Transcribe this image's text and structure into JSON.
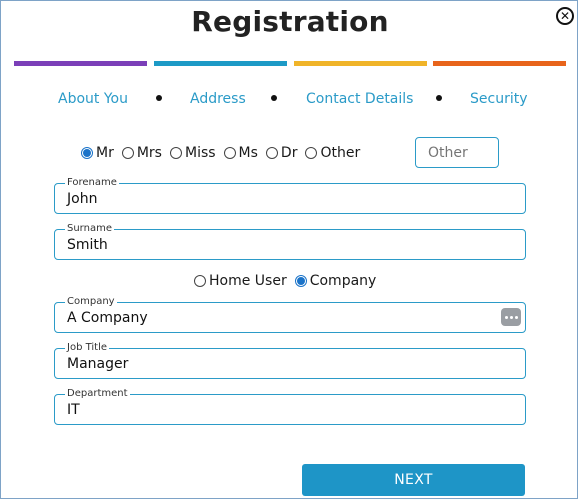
{
  "title": "Registration",
  "steps": [
    {
      "label": "About You",
      "color": "#7b3fb8"
    },
    {
      "label": "Address",
      "color": "#1d9ac6"
    },
    {
      "label": "Contact Details",
      "color": "#f0b429"
    },
    {
      "label": "Security",
      "color": "#e8641b"
    }
  ],
  "titles": {
    "options": [
      "Mr",
      "Mrs",
      "Miss",
      "Ms",
      "Dr",
      "Other"
    ],
    "selected": "Mr",
    "other_placeholder": "Other"
  },
  "forename": {
    "label": "Forename",
    "value": "John"
  },
  "surname": {
    "label": "Surname",
    "value": "Smith"
  },
  "user_type": {
    "options": [
      "Home User",
      "Company"
    ],
    "selected": "Company"
  },
  "company": {
    "label": "Company",
    "value": "A Company"
  },
  "job_title": {
    "label": "Job Title",
    "value": "Manager"
  },
  "department": {
    "label": "Department",
    "value": "IT"
  },
  "next_label": "NEXT",
  "colors": {
    "accent": "#1e95c7",
    "border": "#2b9bc8"
  }
}
